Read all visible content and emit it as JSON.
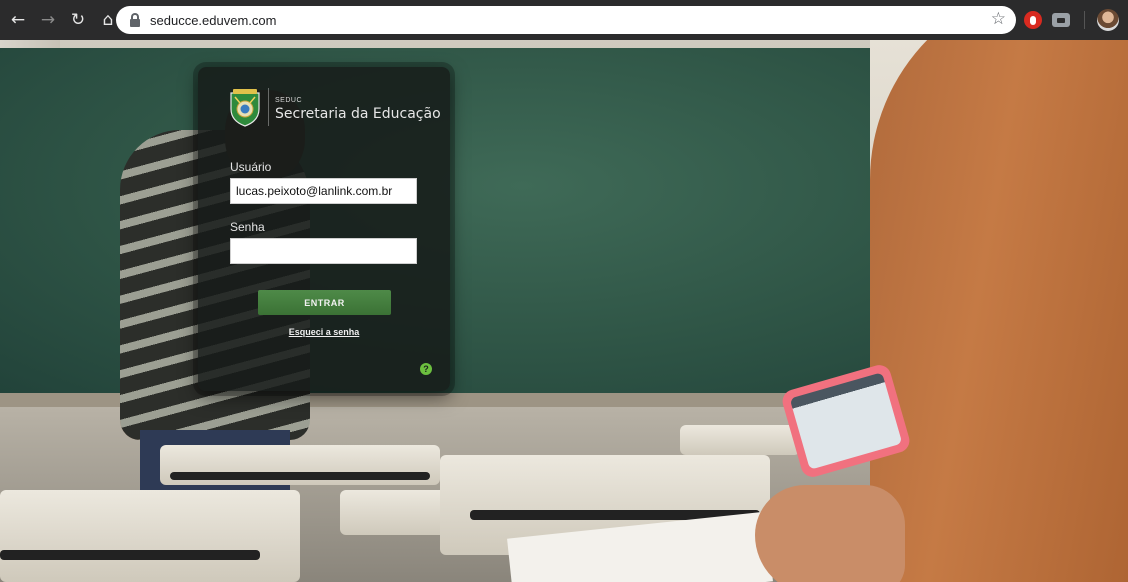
{
  "browser": {
    "url": "seducce.eduvem.com",
    "back_icon": "arrow-left-icon",
    "forward_icon": "arrow-right-icon",
    "reload_icon": "reload-icon",
    "home_icon": "home-icon",
    "bookmark_icon": "star-icon"
  },
  "brand": {
    "abbr": "SEDUC",
    "name": "Secretaria da Educação"
  },
  "login": {
    "username_label": "Usuário",
    "username_value": "lucas.peixoto@lanlink.com.br",
    "password_label": "Senha",
    "password_value": "",
    "submit_label": "ENTRAR",
    "forgot_label": "Esqueci a senha",
    "help_glyph": "?"
  },
  "colors": {
    "button_green": "#4e8a48",
    "help_green": "#6cbf3f",
    "card_background": "#161b19"
  }
}
